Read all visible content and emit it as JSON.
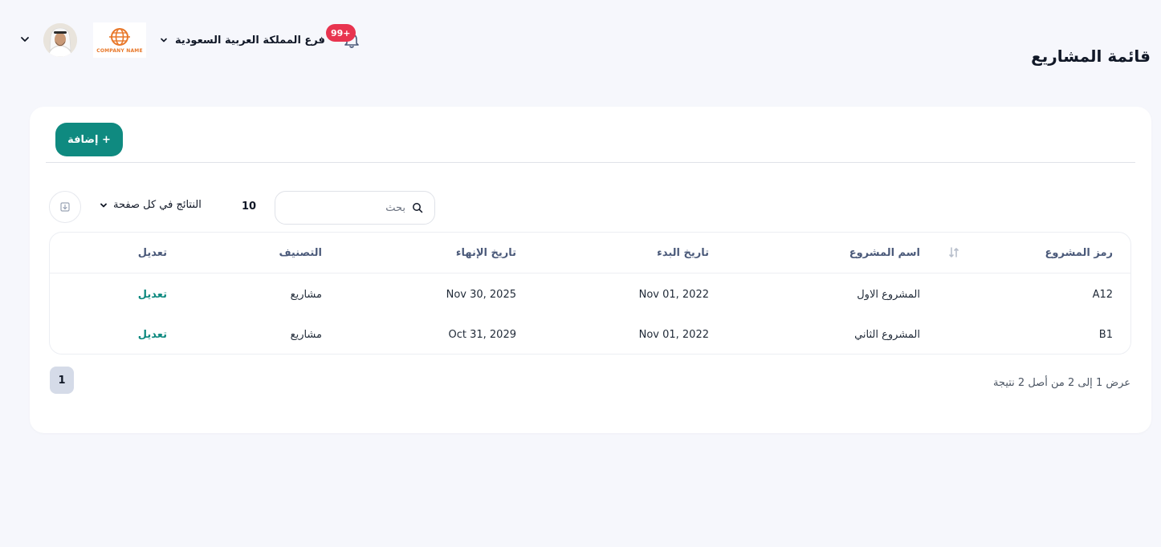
{
  "header": {
    "branch_name": "فرع المملكة العربية السعودية",
    "notification_badge": "99+",
    "company_logo_text": "COMPANY NAME",
    "page_title": "قائمة المشاريع"
  },
  "toolbar": {
    "add_label": "+ إضافة",
    "search_placeholder": "بحث",
    "per_page_value": "10",
    "per_page_label": "النتائج في كل صفحة"
  },
  "table": {
    "columns": [
      "رمز المشروع",
      "اسم المشروع",
      "تاريخ البدء",
      "تاريخ الإنهاء",
      "التصنيف",
      "تعديل"
    ],
    "rows": [
      {
        "code": "A12",
        "name": "المشروع الاول",
        "start": "Nov 01, 2022",
        "end": "Nov 30, 2025",
        "category": "مشاريع",
        "edit": "تعديل"
      },
      {
        "code": "B1",
        "name": "المشروع الثاني",
        "start": "Nov 01, 2022",
        "end": "Oct 31, 2029",
        "category": "مشاريع",
        "edit": "تعديل"
      }
    ]
  },
  "pagination": {
    "summary": "عرض 1 إلى 2 من أصل 2 نتيجة",
    "current_page": "1"
  },
  "colors": {
    "accent": "#0f8a80",
    "badge": "#e8344f",
    "background": "#f6f7fc"
  },
  "icons": [
    "chevron-down-icon",
    "bell-icon",
    "search-icon",
    "sort-icon",
    "export-icon"
  ]
}
